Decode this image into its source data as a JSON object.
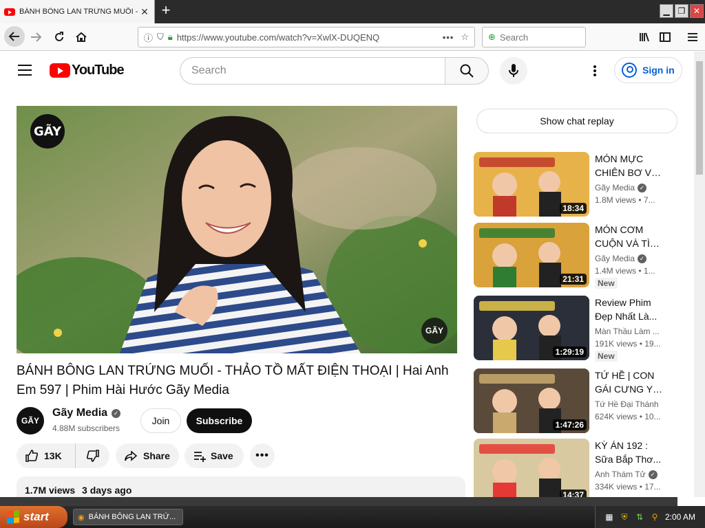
{
  "browser": {
    "tab_title": "BÁNH BÔNG LAN TRỨNG MUỐI - T",
    "tab_close": "✕",
    "new_tab": "+",
    "url": "https://www.youtube.com/watch?v=XwlX-DUQENQ",
    "search_placeholder": "Search",
    "page_actions": "•••"
  },
  "youtube": {
    "logo_text": "YouTube",
    "search_placeholder": "Search",
    "sign_in": "Sign in"
  },
  "video": {
    "title": "BÁNH BÔNG LAN TRỨNG MUỐI - THẢO TỒ MẤT ĐIỆN THOẠI | Hai Anh Em 597 | Phim Hài Hước Gãy Media",
    "channel_badge": "GÃY",
    "watermark": "GÃY",
    "channel_name": "Gãy Media",
    "subscribers": "4.88M subscribers",
    "join_label": "Join",
    "subscribe_label": "Subscribe",
    "likes": "13K",
    "share_label": "Share",
    "save_label": "Save",
    "views": "1.7M views",
    "age": "3 days ago"
  },
  "sidebar": {
    "chat_replay": "Show chat replay",
    "recommendations": [
      {
        "title_l1": "MÓN MỰC",
        "title_l2": "CHIÊN BƠ VÀ...",
        "channel": "Gãy Media",
        "verified": true,
        "meta": "1.8M views  • 7...",
        "duration": "18:34",
        "new": "",
        "thumb_bg": "#e8b24a",
        "thumb_accent": "#c0392b"
      },
      {
        "title_l1": "MÓN CƠM",
        "title_l2": "CUỘN VÀ TÌN...",
        "channel": "Gãy Media",
        "verified": true,
        "meta": "1.4M views  • 1...",
        "duration": "21:31",
        "new": "New",
        "thumb_bg": "#d9a23a",
        "thumb_accent": "#2e7d32"
      },
      {
        "title_l1": "Review Phim",
        "title_l2": "Đẹp Nhất Là...",
        "channel": "Màn Thầu Làm ...",
        "verified": false,
        "meta": "191K views  • 19...",
        "duration": "1:29:19",
        "new": "New",
        "thumb_bg": "#2b2f3a",
        "thumb_accent": "#e6c84a"
      },
      {
        "title_l1": "TỨ HỀ | CON",
        "title_l2": "GÁI CƯNG YÊ...",
        "channel": "Tứ Hề Đại Thánh",
        "verified": false,
        "meta": "624K views  • 10...",
        "duration": "1:47:26",
        "new": "",
        "thumb_bg": "#5a4a3a",
        "thumb_accent": "#c9a96e"
      },
      {
        "title_l1": "KỲ ÁN 192 :",
        "title_l2": "Sữa Bắp Thơ...",
        "channel": "Anh Thám Tử",
        "verified": true,
        "meta": "334K views  • 17...",
        "duration": "14:37",
        "new": "",
        "thumb_bg": "#d8c9a0",
        "thumb_accent": "#e53935"
      }
    ]
  },
  "taskbar": {
    "start_label": "start",
    "task_title": "BÁNH BÔNG LAN TRỨ...",
    "clock": "2:00 AM"
  },
  "colors": {
    "yt_red": "#ff0000",
    "link_blue": "#065fd4",
    "start_orange": "#d2611f"
  }
}
